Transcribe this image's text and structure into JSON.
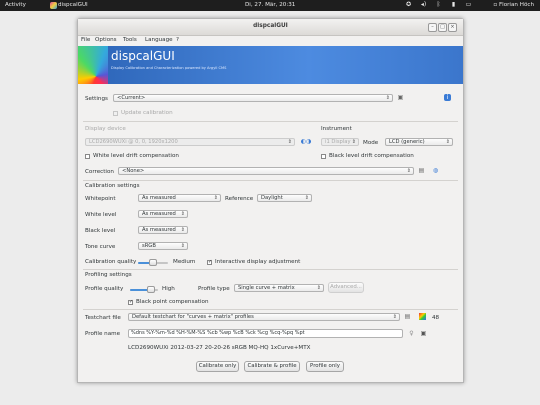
{
  "topbar": {
    "activities": "Activity",
    "app_name": "dispcalGUI",
    "clock": "Di, 27. Mär, 20:31",
    "user": "Florian Höch"
  },
  "window": {
    "title": "dispcalGUI",
    "menu": [
      "File",
      "Options",
      "Tools",
      "Language",
      "?"
    ],
    "banner_title": "dispcalGUI",
    "banner_subtitle": "Display Calibration and Characterization powered by Argyll CMS"
  },
  "settings": {
    "label": "Settings",
    "value": "<Current>",
    "update_calibration": "Update calibration"
  },
  "display": {
    "section": "Display device",
    "value": "LCD2690WUXi @ 0, 0, 1920x1200",
    "white_drift": "White level drift compensation",
    "correction_label": "Correction",
    "correction_value": "<None>"
  },
  "instrument": {
    "section": "Instrument",
    "value": "i1 Display",
    "mode_label": "Mode",
    "mode_value": "LCD (generic)",
    "black_drift": "Black level drift compensation"
  },
  "calibration": {
    "section": "Calibration settings",
    "whitepoint_label": "Whitepoint",
    "whitepoint_value": "As measured",
    "reference_label": "Reference",
    "reference_value": "Daylight",
    "white_level_label": "White level",
    "white_level_value": "As measured",
    "black_level_label": "Black level",
    "black_level_value": "As measured",
    "tone_curve_label": "Tone curve",
    "tone_curve_value": "sRGB",
    "quality_label": "Calibration quality",
    "quality_value": "Medium",
    "quality_level": 0.5,
    "interactive": "Interactive display adjustment"
  },
  "profiling": {
    "section": "Profiling settings",
    "quality_label": "Profile quality",
    "quality_value": "High",
    "quality_level": 0.75,
    "type_label": "Profile type",
    "type_value": "Single curve + matrix",
    "advanced": "Advanced...",
    "black_point": "Black point compensation",
    "testchart_label": "Testchart file",
    "testchart_value": "Default testchart for \"curves + matrix\" profiles",
    "patch_count": "48",
    "name_label": "Profile name",
    "name_value": "%dns %Y-%m-%d %H-%M-%S %cb %wp %cB %ck %cg %cq-%pq %pt",
    "name_preview": "LCD2690WUXi 2012-03-27 20-20-26 sRGB MQ-HQ 1xCurve+MTX"
  },
  "actions": {
    "calibrate_only": "Calibrate only",
    "calibrate_profile": "Calibrate & profile",
    "profile_only": "Profile only"
  },
  "colors": {
    "accent": "#4a90d9",
    "banner": "#2b63b6",
    "topbar": "#1e1e1e"
  }
}
